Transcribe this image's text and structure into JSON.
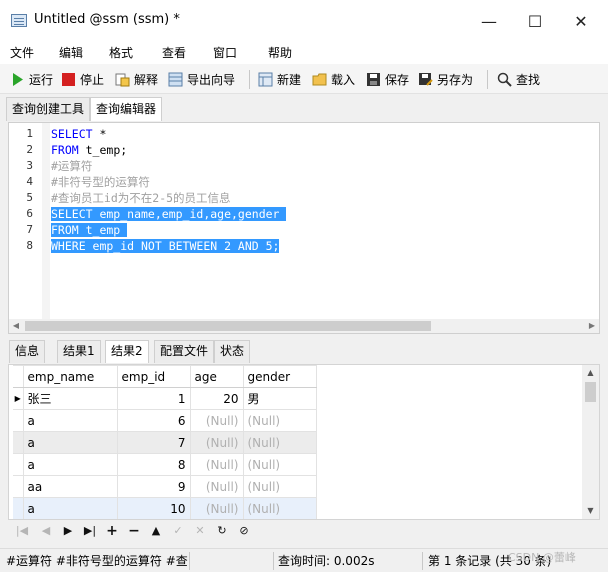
{
  "window": {
    "title": "Untitled @ssm (ssm) *",
    "minimize": "—",
    "maximize": "☐",
    "close": "✕"
  },
  "menu": [
    "文件",
    "编辑",
    "格式",
    "查看",
    "窗口",
    "帮助"
  ],
  "toolbar": {
    "run": "运行",
    "stop": "停止",
    "explain": "解释",
    "export_wizard": "导出向导",
    "new": "新建",
    "load": "载入",
    "save": "保存",
    "save_as": "另存为",
    "find": "查找"
  },
  "top_tabs": [
    "查询创建工具",
    "查询编辑器"
  ],
  "editor": {
    "line_numbers": [
      "1",
      "2",
      "3",
      "4",
      "5",
      "6",
      "7",
      "8"
    ],
    "lines": [
      {
        "kw": "SELECT",
        "rest": " *"
      },
      {
        "kw": "FROM",
        "rest": " t_emp;"
      },
      {
        "comment": "#运算符"
      },
      {
        "comment": "#非符号型的运算符"
      },
      {
        "comment": "#查询员工id为不在2-5的员工信息"
      },
      {
        "text": "SELECT emp_name,emp_id,age,gender "
      },
      {
        "text": "FROM t_emp "
      },
      {
        "text": "WHERE emp_id NOT BETWEEN 2 AND 5;"
      }
    ]
  },
  "bottom_tabs": [
    "信息",
    "结果1",
    "结果2",
    "配置文件",
    "状态"
  ],
  "result": {
    "columns": [
      "emp_name",
      "emp_id",
      "age",
      "gender"
    ],
    "rows": [
      [
        "张三",
        "1",
        "20",
        "男"
      ],
      [
        "a",
        "6",
        "(Null)",
        "(Null)"
      ],
      [
        "a",
        "7",
        "(Null)",
        "(Null)"
      ],
      [
        "a",
        "8",
        "(Null)",
        "(Null)"
      ],
      [
        "aa",
        "9",
        "(Null)",
        "(Null)"
      ],
      [
        "a",
        "10",
        "(Null)",
        "(Null)"
      ]
    ]
  },
  "nav_icons": [
    "first-icon",
    "prev-icon",
    "next-icon",
    "last-icon",
    "add-icon",
    "delete-icon",
    "up-icon",
    "check-icon",
    "cancel-icon",
    "refresh-icon",
    "stop-icon"
  ],
  "status": {
    "sql": "#运算符 #非符号型的运算符 #查询",
    "query_time": "查询时间: 0.002s",
    "record": "第 1 条记录 (共 30 条)",
    "watermark": "CSDN @蕾峰"
  }
}
